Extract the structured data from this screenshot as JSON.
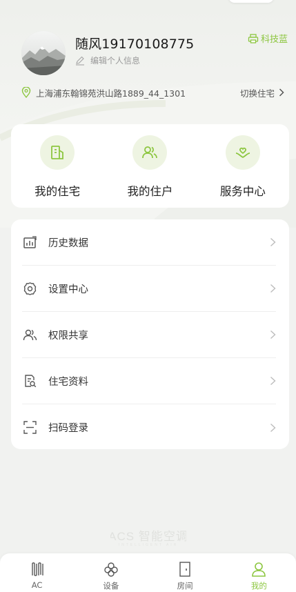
{
  "colors": {
    "accent": "#8cc63f",
    "accent_bg": "#eef4e2",
    "background": "#f1f2f0",
    "card": "#ffffff"
  },
  "profile": {
    "name": "随风19170108775",
    "edit_label": "编辑个人信息",
    "theme_label": "科技蓝",
    "address": "上海浦东翰锦苑洪山路1889_44_1301",
    "switch_label": "切换住宅"
  },
  "quick_actions": [
    {
      "label": "我的住宅",
      "icon": "residence-icon"
    },
    {
      "label": "我的住户",
      "icon": "residents-icon"
    },
    {
      "label": "服务中心",
      "icon": "service-center-icon"
    }
  ],
  "menu": [
    {
      "label": "历史数据",
      "icon": "history-chart-icon"
    },
    {
      "label": "设置中心",
      "icon": "settings-gear-icon"
    },
    {
      "label": "权限共享",
      "icon": "share-users-icon"
    },
    {
      "label": "住宅资料",
      "icon": "document-search-icon"
    },
    {
      "label": "扫码登录",
      "icon": "scan-icon"
    }
  ],
  "tabs": [
    {
      "label": "AC",
      "icon": "ac-icon",
      "active": false
    },
    {
      "label": "设备",
      "icon": "device-icon",
      "active": false
    },
    {
      "label": "房间",
      "icon": "door-icon",
      "active": false
    },
    {
      "label": "我的",
      "icon": "profile-icon",
      "active": true
    }
  ]
}
